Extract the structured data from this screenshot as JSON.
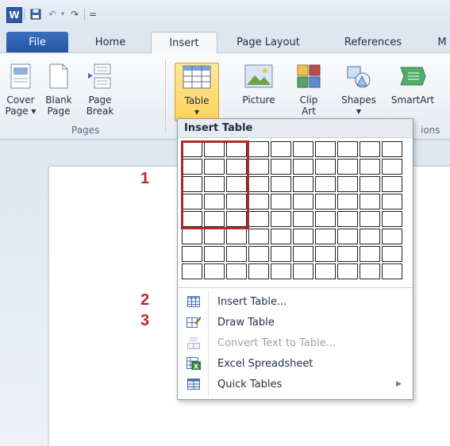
{
  "app": {
    "logo_letter": "W"
  },
  "qat": {
    "undo": "↶",
    "dropdown": "▾",
    "redo": "↷",
    "customize": "="
  },
  "tabs": [
    {
      "label": "File"
    },
    {
      "label": "Home"
    },
    {
      "label": "Insert"
    },
    {
      "label": "Page Layout"
    },
    {
      "label": "References"
    },
    {
      "label": "M"
    }
  ],
  "ribbon": {
    "buttons": [
      {
        "label": "Cover\nPage ▾"
      },
      {
        "label": "Blank\nPage"
      },
      {
        "label": "Page\nBreak"
      },
      {
        "label": "Table\n▾"
      },
      {
        "label": "Picture"
      },
      {
        "label": "Clip\nArt"
      },
      {
        "label": "Shapes\n▾"
      },
      {
        "label": "SmartArt"
      }
    ],
    "groups": {
      "pages": "Pages",
      "illustrations_partial": "ions"
    }
  },
  "dropdown": {
    "title": "Insert Table",
    "grid": {
      "columns": 10,
      "rows": 8,
      "selected_columns": 3,
      "selected_rows": 5
    },
    "menu": [
      {
        "label": "Insert Table...",
        "icon": "table-icon",
        "disabled": false
      },
      {
        "label": "Draw Table",
        "icon": "pencil-table-icon",
        "disabled": false
      },
      {
        "label": "Convert Text to Table...",
        "icon": "convert-icon",
        "disabled": true
      },
      {
        "label": "Excel Spreadsheet",
        "icon": "excel-icon",
        "disabled": false
      },
      {
        "label": "Quick Tables",
        "icon": "quick-tables-icon",
        "disabled": false,
        "submenu": true
      }
    ]
  },
  "annotations": {
    "m1": "1",
    "m2": "2",
    "m3": "3"
  },
  "colors": {
    "accent": "#2a5caa",
    "selection": "#b12a26",
    "active_button": "#ffd25a"
  }
}
